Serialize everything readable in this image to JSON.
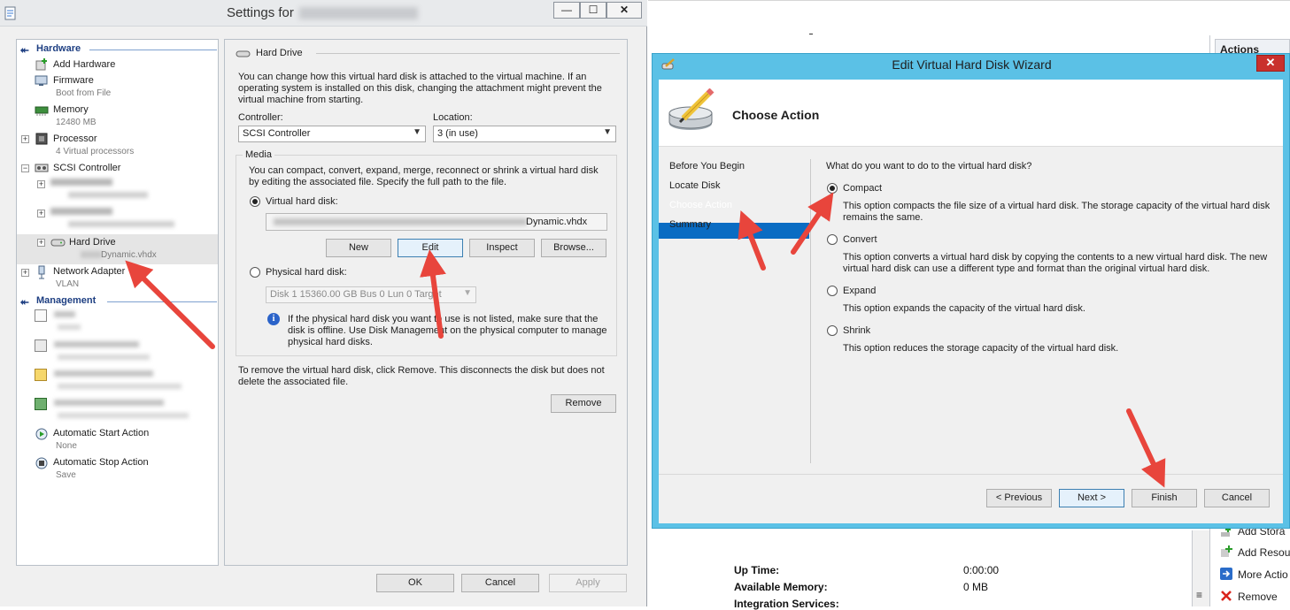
{
  "settings": {
    "title": "Settings for",
    "title_hidden": "",
    "min": "—",
    "max": "☐",
    "close": "✕",
    "tree": {
      "hardware_header": "Hardware",
      "add_hardware": "Add Hardware",
      "firmware": "Firmware",
      "firmware_sub": "Boot from File",
      "memory": "Memory",
      "memory_sub": "12480 MB",
      "processor": "Processor",
      "processor_sub": "4 Virtual processors",
      "scsi": "SCSI Controller",
      "hard_drive": "Hard Drive",
      "hard_drive_sub": "Dynamic.vhdx",
      "network": "Network Adapter",
      "network_sub": "VLAN",
      "management_header": "Management",
      "auto_start": "Automatic Start Action",
      "auto_start_sub": "None",
      "auto_stop": "Automatic Stop Action",
      "auto_stop_sub": "Save"
    },
    "panel": {
      "header": "Hard Drive",
      "intro": "You can change how this virtual hard disk is attached to the virtual machine. If an operating system is installed on this disk, changing the attachment might prevent the virtual machine from starting.",
      "controller_label": "Controller:",
      "controller_value": "SCSI Controller",
      "location_label": "Location:",
      "location_value": "3 (in use)",
      "media_label": "Media",
      "media_desc": "You can compact, convert, expand, merge, reconnect or shrink a virtual hard disk by editing the associated file. Specify the full path to the file.",
      "vhd_label": "Virtual hard disk:",
      "vhd_path_suffix": "Dynamic.vhdx",
      "btn_new": "New",
      "btn_edit": "Edit",
      "btn_inspect": "Inspect",
      "btn_browse": "Browse...",
      "phys_label": "Physical hard disk:",
      "phys_value": "Disk 1 15360.00 GB Bus 0 Lun 0 Target",
      "phys_info": "If the physical hard disk you want to use is not listed, make sure that the disk is offline. Use Disk Management on the physical computer to manage physical hard disks.",
      "remove_text": "To remove the virtual hard disk, click Remove. This disconnects the disk but does not delete the associated file.",
      "btn_remove": "Remove"
    },
    "footer": {
      "ok": "OK",
      "cancel": "Cancel",
      "apply": "Apply"
    }
  },
  "background": {
    "actions_header": "Actions",
    "actions": [
      "Add Stora",
      "Add Resou",
      "More Actio",
      "Remove"
    ],
    "uptime_label": "Up Time:",
    "uptime_value": "0:00:00",
    "memory_label": "Available Memory:",
    "memory_value": "0 MB",
    "integration_label": "Integration Services:"
  },
  "wizard": {
    "title": "Edit Virtual Hard Disk Wizard",
    "close": "✕",
    "heading": "Choose Action",
    "nav": [
      "Before You Begin",
      "Locate Disk",
      "Choose Action",
      "Summary"
    ],
    "question": "What do you want to do to the virtual hard disk?",
    "options": [
      {
        "label": "Compact",
        "desc": "This option compacts the file size of a virtual hard disk. The storage capacity of the virtual hard disk remains the same.",
        "selected": true
      },
      {
        "label": "Convert",
        "desc": "This option converts a virtual hard disk by copying the contents to a new virtual hard disk. The new virtual hard disk can use a different type and format than the original virtual hard disk.",
        "selected": false
      },
      {
        "label": "Expand",
        "desc": "This option expands the capacity of the virtual hard disk.",
        "selected": false
      },
      {
        "label": "Shrink",
        "desc": "This option reduces the storage capacity of the virtual hard disk.",
        "selected": false
      }
    ],
    "btn_previous": "< Previous",
    "btn_next": "Next >",
    "btn_finish": "Finish",
    "btn_cancel": "Cancel"
  },
  "colors": {
    "wizard_frame": "#5bc1e6",
    "nav_selected": "#0a6cc3",
    "section_header": "#1e3f82",
    "annotation_arrow": "#e8453c"
  }
}
